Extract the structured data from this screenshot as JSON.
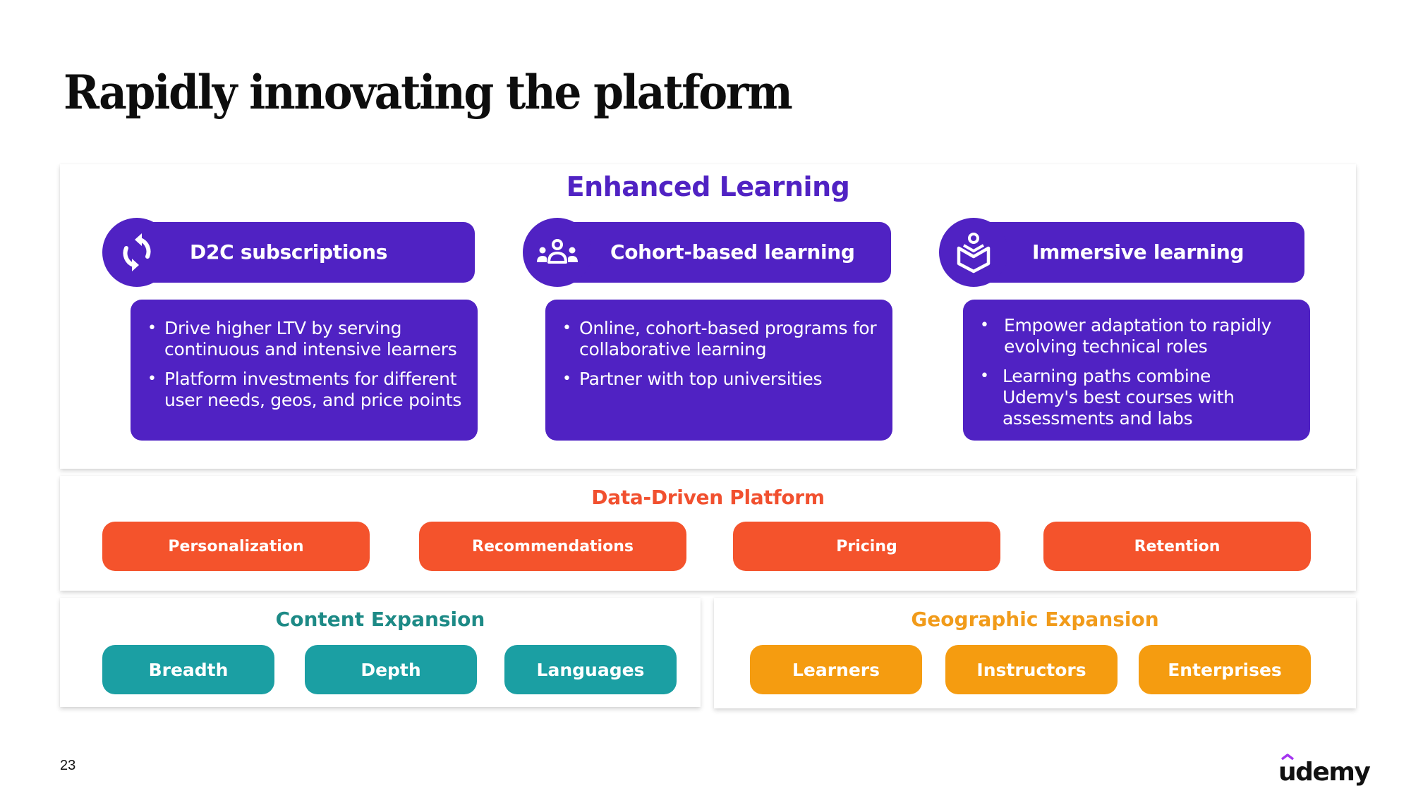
{
  "slide": {
    "title": "Rapidly innovating the platform",
    "page_number": "23",
    "logo_text": "udemy"
  },
  "colors": {
    "purple": "#5022c3",
    "orange": "#f4532c",
    "teal": "#1b9fa3",
    "amber": "#f59c10"
  },
  "enhanced_learning": {
    "title": "Enhanced Learning",
    "columns": [
      {
        "icon": "refresh-icon",
        "label": "D2C subscriptions",
        "bullets": [
          "Drive higher LTV by serving continuous and intensive learners",
          "Platform investments for different user needs, geos, and price points"
        ]
      },
      {
        "icon": "group-icon",
        "label": "Cohort-based learning",
        "bullets": [
          "Online, cohort-based programs for collaborative learning",
          "Partner with top universities"
        ]
      },
      {
        "icon": "reader-book-icon",
        "label": "Immersive learning",
        "bullets": [
          "Empower adaptation to rapidly evolving technical roles",
          "Learning paths combine Udemy's best courses with assessments and labs"
        ]
      }
    ]
  },
  "data_driven": {
    "title": "Data-Driven Platform",
    "items": [
      "Personalization",
      "Recommendations",
      "Pricing",
      "Retention"
    ]
  },
  "content_expansion": {
    "title": "Content Expansion",
    "items": [
      "Breadth",
      "Depth",
      "Languages"
    ]
  },
  "geographic_expansion": {
    "title": "Geographic Expansion",
    "items": [
      "Learners",
      "Instructors",
      "Enterprises"
    ]
  }
}
